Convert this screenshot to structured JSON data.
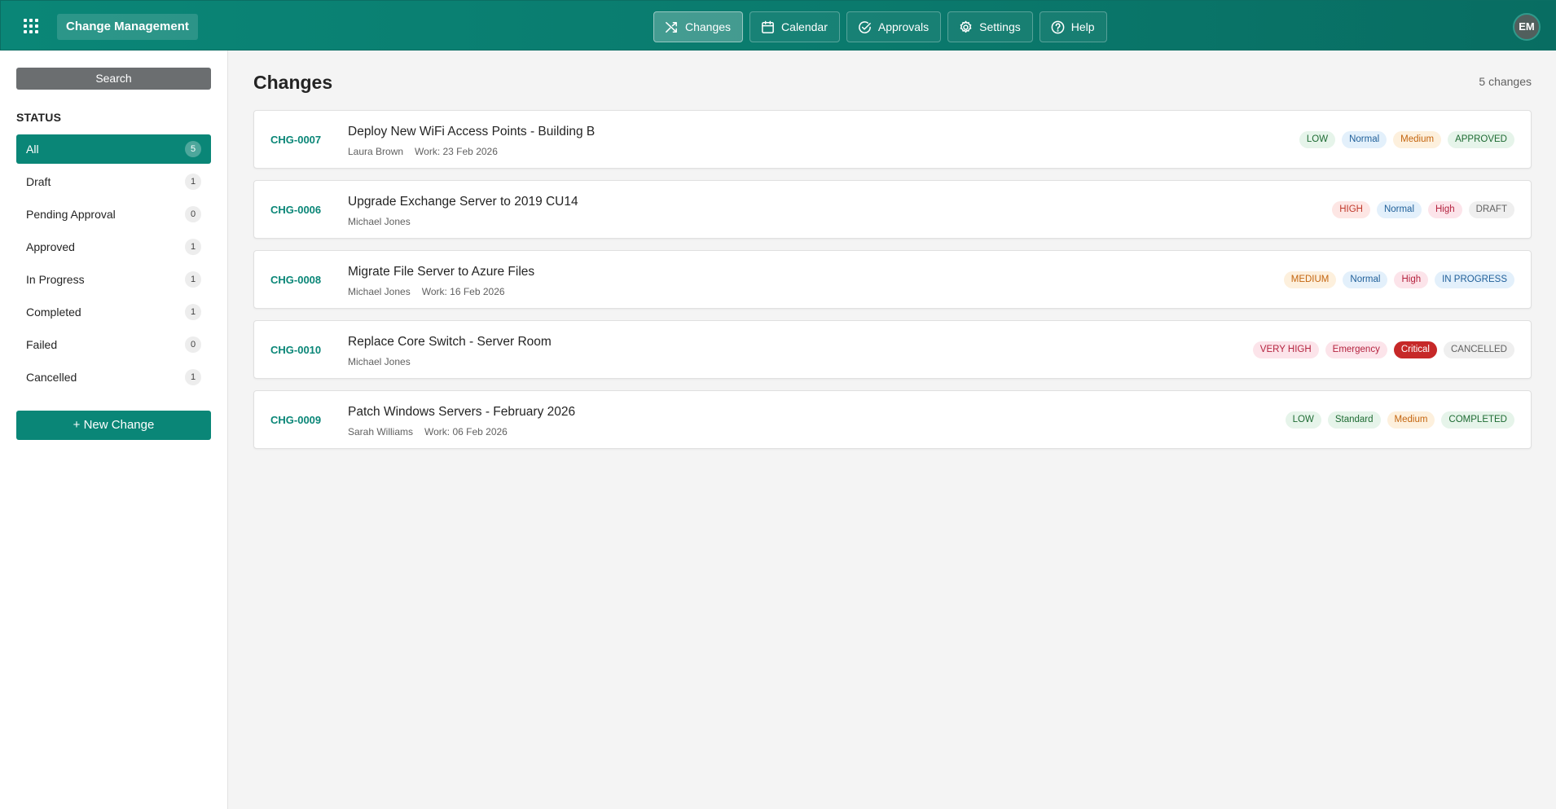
{
  "header": {
    "app_title": "Change Management",
    "nav": [
      {
        "label": "Changes",
        "icon": "shuffle-icon",
        "active": true
      },
      {
        "label": "Calendar",
        "icon": "calendar-icon",
        "active": false
      },
      {
        "label": "Approvals",
        "icon": "check-circle-icon",
        "active": false
      },
      {
        "label": "Settings",
        "icon": "gear-icon",
        "active": false
      },
      {
        "label": "Help",
        "icon": "question-circle-icon",
        "active": false
      }
    ],
    "avatar_initials": "EM"
  },
  "sidebar": {
    "search_label": "Search",
    "status_heading": "STATUS",
    "statuses": [
      {
        "label": "All",
        "count": "5",
        "active": true
      },
      {
        "label": "Draft",
        "count": "1",
        "active": false
      },
      {
        "label": "Pending Approval",
        "count": "0",
        "active": false
      },
      {
        "label": "Approved",
        "count": "1",
        "active": false
      },
      {
        "label": "In Progress",
        "count": "1",
        "active": false
      },
      {
        "label": "Completed",
        "count": "1",
        "active": false
      },
      {
        "label": "Failed",
        "count": "0",
        "active": false
      },
      {
        "label": "Cancelled",
        "count": "1",
        "active": false
      }
    ],
    "new_change_label": "+ New Change"
  },
  "main": {
    "title": "Changes",
    "total": "5 changes",
    "changes": [
      {
        "id": "CHG-0007",
        "title": "Deploy New WiFi Access Points - Building B",
        "owner": "Laura Brown",
        "work": "Work: 23 Feb 2026",
        "badges": [
          {
            "text": "LOW",
            "style": "green"
          },
          {
            "text": "Normal",
            "style": "blue"
          },
          {
            "text": "Medium",
            "style": "orange"
          },
          {
            "text": "APPROVED",
            "style": "green"
          }
        ]
      },
      {
        "id": "CHG-0006",
        "title": "Upgrade Exchange Server to 2019 CU14",
        "owner": "Michael Jones",
        "work": "",
        "badges": [
          {
            "text": "HIGH",
            "style": "red"
          },
          {
            "text": "Normal",
            "style": "blue"
          },
          {
            "text": "High",
            "style": "pink"
          },
          {
            "text": "DRAFT",
            "style": "grey"
          }
        ]
      },
      {
        "id": "CHG-0008",
        "title": "Migrate File Server to Azure Files",
        "owner": "Michael Jones",
        "work": "Work: 16 Feb 2026",
        "badges": [
          {
            "text": "MEDIUM",
            "style": "orange"
          },
          {
            "text": "Normal",
            "style": "blue"
          },
          {
            "text": "High",
            "style": "pink"
          },
          {
            "text": "IN PROGRESS",
            "style": "blue"
          }
        ]
      },
      {
        "id": "CHG-0010",
        "title": "Replace Core Switch - Server Room",
        "owner": "Michael Jones",
        "work": "",
        "badges": [
          {
            "text": "VERY HIGH",
            "style": "pink"
          },
          {
            "text": "Emergency",
            "style": "pink"
          },
          {
            "text": "Critical",
            "style": "critical"
          },
          {
            "text": "CANCELLED",
            "style": "grey"
          }
        ]
      },
      {
        "id": "CHG-0009",
        "title": "Patch Windows Servers - February 2026",
        "owner": "Sarah Williams",
        "work": "Work: 06 Feb 2026",
        "badges": [
          {
            "text": "LOW",
            "style": "green"
          },
          {
            "text": "Standard",
            "style": "green"
          },
          {
            "text": "Medium",
            "style": "orange"
          },
          {
            "text": "COMPLETED",
            "style": "green"
          }
        ]
      }
    ]
  },
  "colors": {
    "brand": "#0a8677",
    "badge_styles": {
      "green": {
        "bg": "#e6f4ea",
        "fg": "#1e6b33"
      },
      "blue": {
        "bg": "#e3f0fb",
        "fg": "#1f5f99"
      },
      "orange": {
        "bg": "#fdf0dd",
        "fg": "#c4650f"
      },
      "red": {
        "bg": "#fde6e4",
        "fg": "#c0392b"
      },
      "pink": {
        "bg": "#fce4ea",
        "fg": "#b4233f"
      },
      "grey": {
        "bg": "#efefef",
        "fg": "#616161"
      },
      "critical": {
        "bg": "#c62828",
        "fg": "#ffffff"
      }
    }
  }
}
